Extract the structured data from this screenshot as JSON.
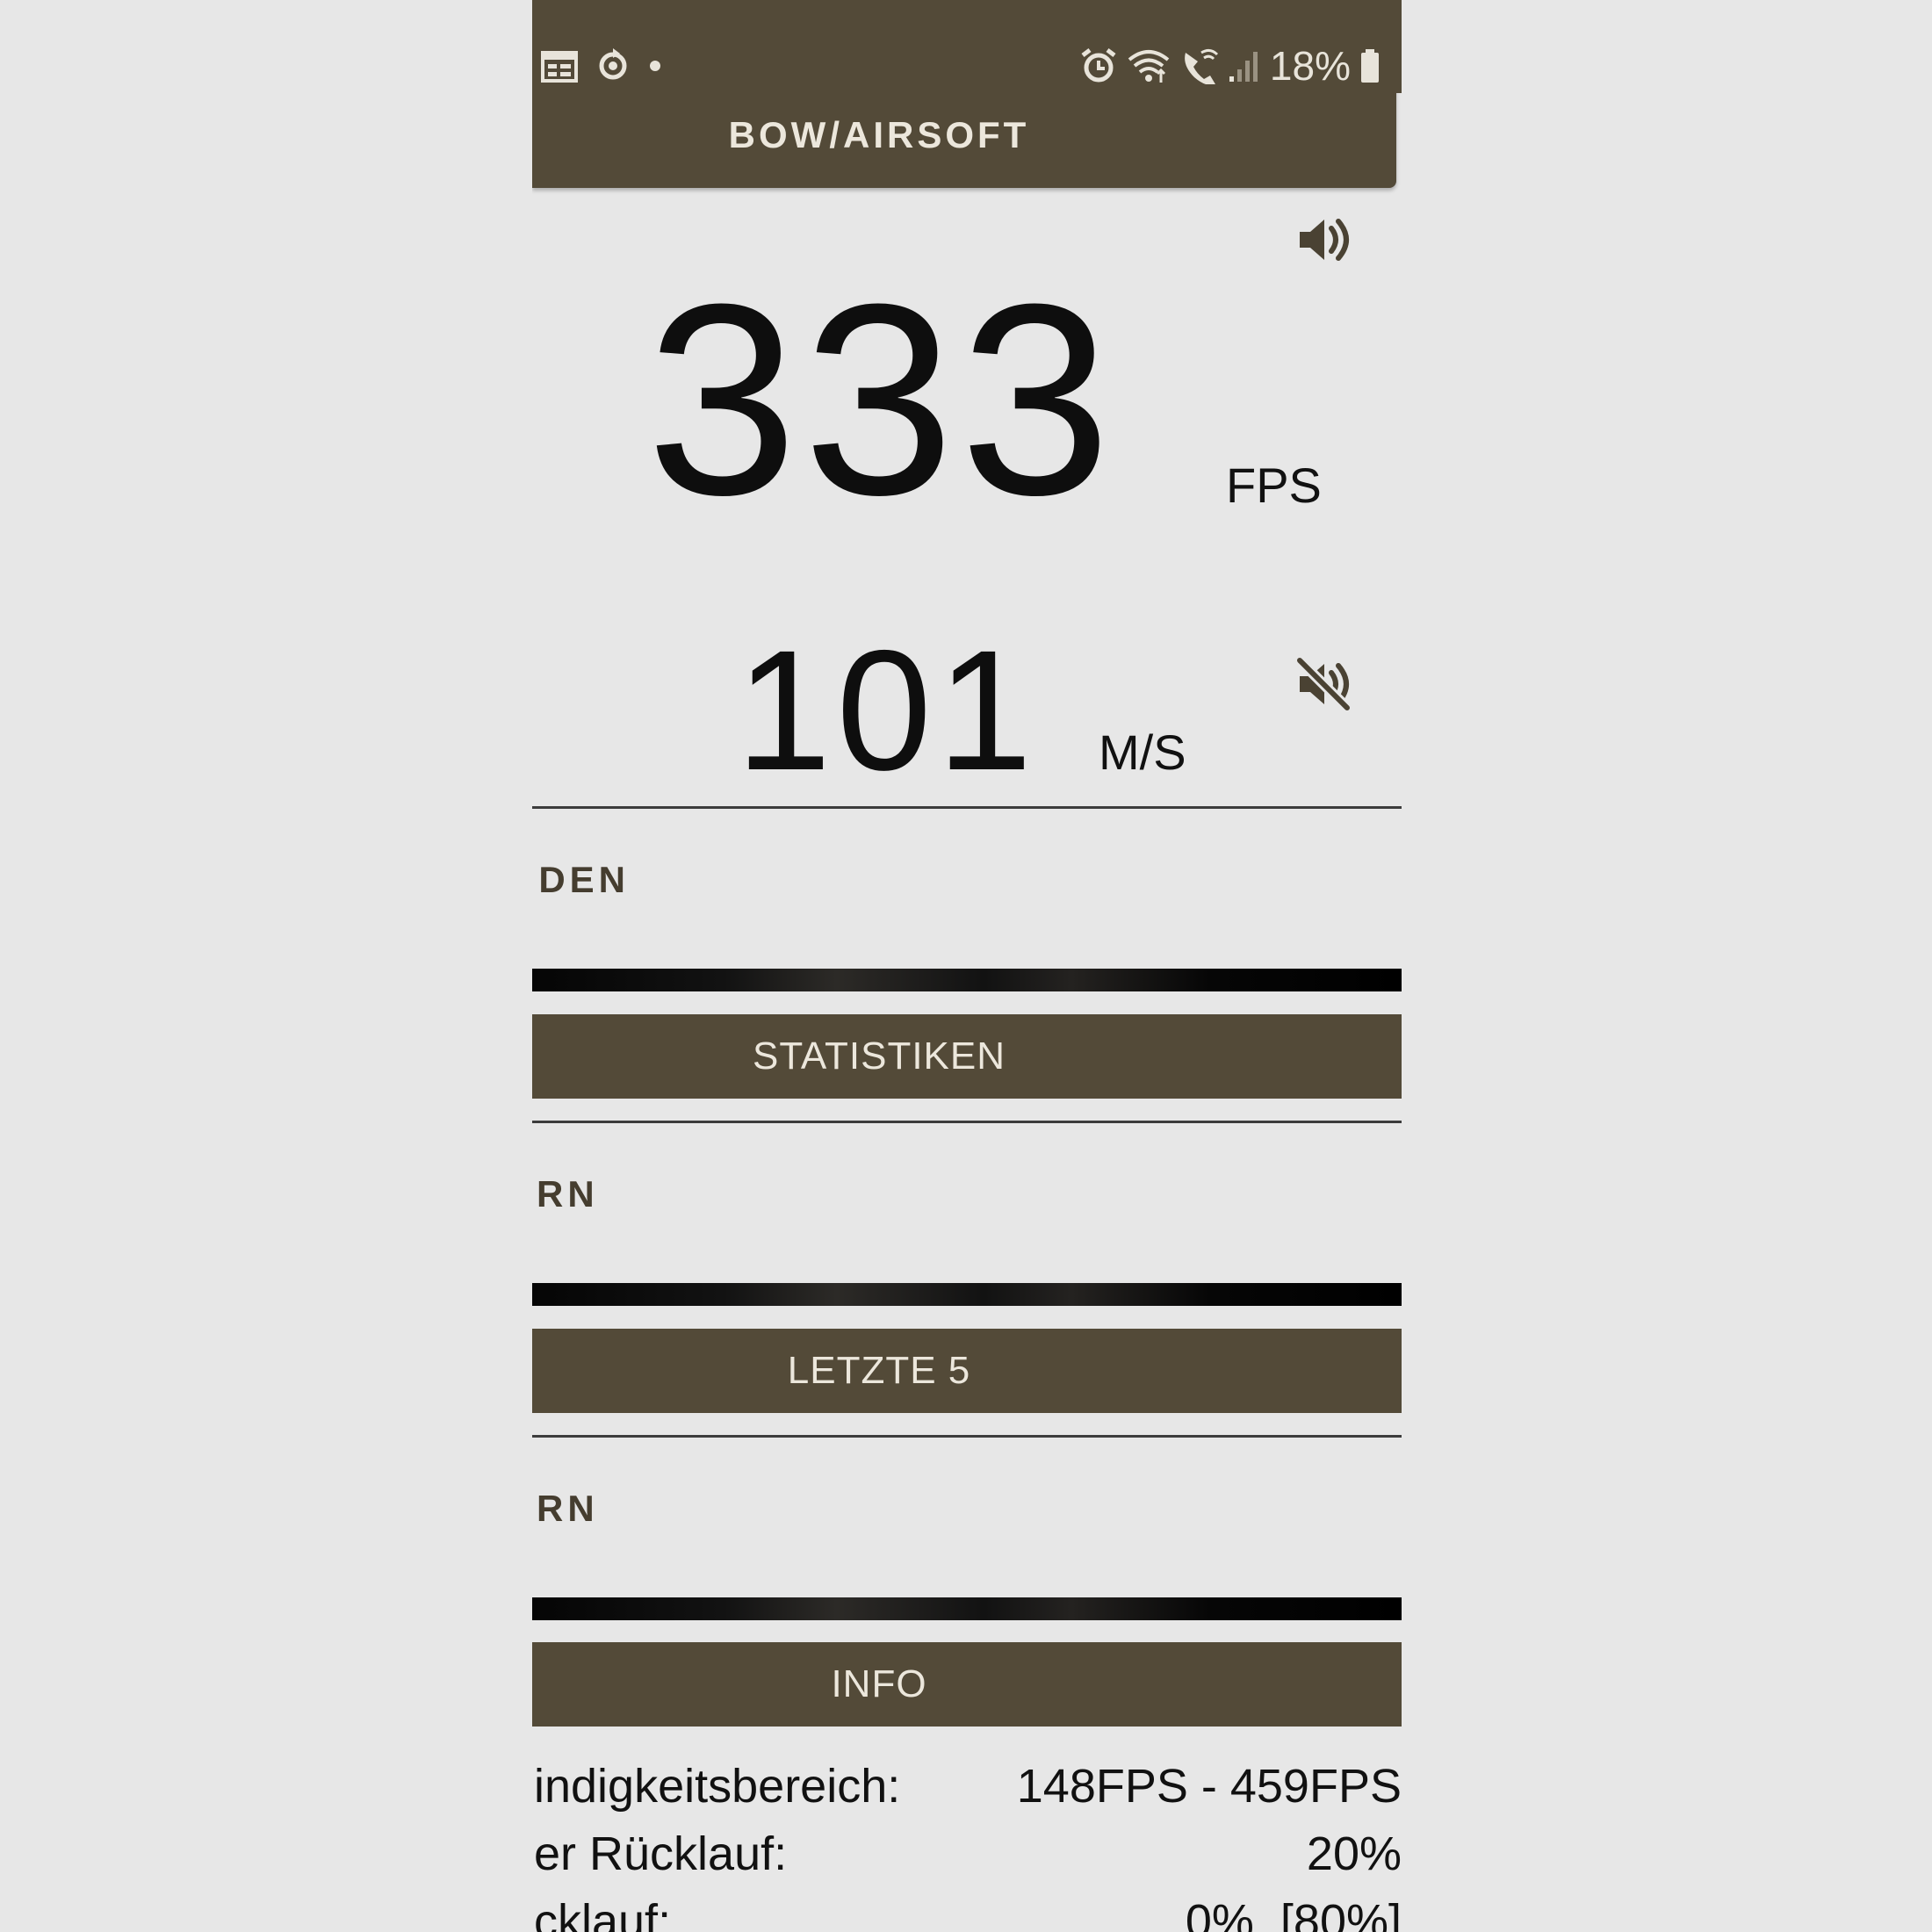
{
  "status_bar": {
    "battery": "18%",
    "colors": {
      "bar": "#534a38",
      "icon": "#e8e4da"
    }
  },
  "app_title": "BOW/AIRSOFT",
  "reading": {
    "fps_value": "333",
    "fps_unit": "FPS",
    "ms_value": "101",
    "ms_unit": "M/S"
  },
  "sections": [
    {
      "label": "NDEN",
      "button": "STATISTIKEN"
    },
    {
      "label": "ERN",
      "button": "LETZTE 5"
    },
    {
      "label": "ERN",
      "button": "INFO"
    }
  ],
  "info_rows": [
    {
      "label": "indigkeitsbereich:",
      "value": "148FPS - 459FPS"
    },
    {
      "label": "er Rücklauf:",
      "value": "20%"
    },
    {
      "label": "cklauf:",
      "value": "0%  [80%]"
    }
  ],
  "icons": {
    "speaker_on": "speaker-on-icon",
    "speaker_muted": "speaker-muted-icon"
  },
  "theme": {
    "accent": "#534a38",
    "background": "#e7e7e7",
    "button_text": "#ece7dc"
  }
}
